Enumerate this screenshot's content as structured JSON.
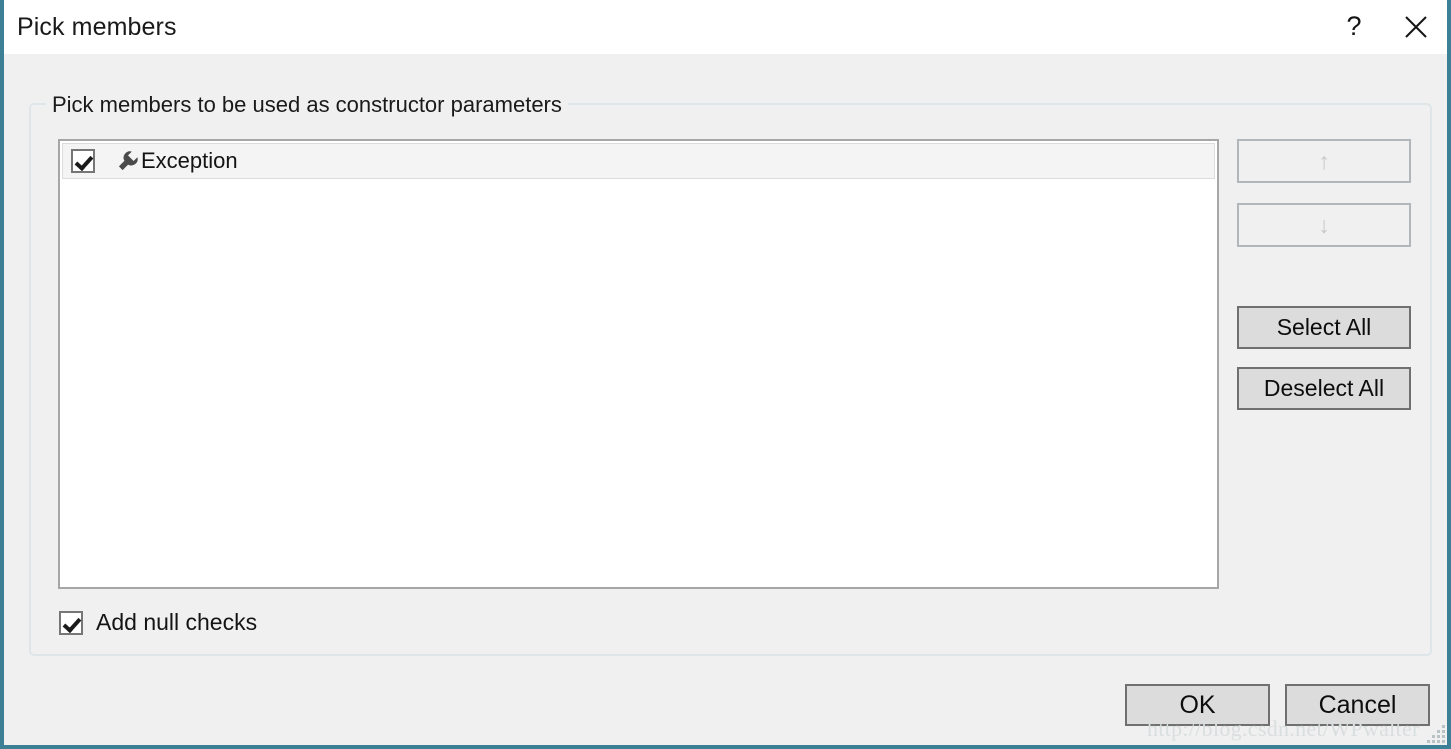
{
  "window": {
    "title": "Pick members",
    "border_color": "#3d7f95",
    "background": "#f0f0f0",
    "titlebar_background": "#ffffff",
    "buttons": [
      {
        "name": "help",
        "glyph": "?"
      },
      {
        "name": "close",
        "glyph": "✕"
      }
    ]
  },
  "groupbox": {
    "label": "Pick members to be used as constructor parameters"
  },
  "listbox": {
    "items": [
      {
        "label": "Exception",
        "checked": true,
        "icon": "wrench-icon",
        "selected": true
      }
    ]
  },
  "side_buttons": [
    {
      "id": "up",
      "label": "↑",
      "enabled": false
    },
    {
      "id": "down",
      "label": "↓",
      "enabled": false
    },
    {
      "id": "select_all",
      "label": "Select All",
      "enabled": true
    },
    {
      "id": "deselect_all",
      "label": "Deselect All",
      "enabled": true
    }
  ],
  "options": {
    "add_null_checks": {
      "label": "Add null checks",
      "checked": true
    }
  },
  "footer": {
    "ok_label": "OK",
    "cancel_label": "Cancel"
  },
  "watermark": {
    "text": "http://blog.csdn.net/WPwalter"
  }
}
